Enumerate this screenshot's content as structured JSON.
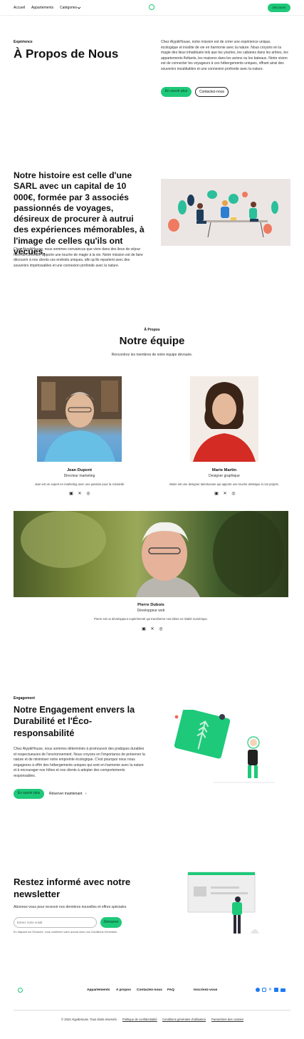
{
  "nav": {
    "links": [
      "Accueil",
      "Appartements",
      "Catégories"
    ],
    "cta": "Découvrir"
  },
  "about": {
    "kicker": "Expérience",
    "title": "À Propos de Nous",
    "text": "Chez AtypikHouse, notre mission est de créer une expérience unique, écologique et insolite de vie en harmonie avec la nature. Nous croyons en la magie des lieux inhabituels tels que les yourtes, les cabanes dans les arbres, les appartements flottants, les maisons dans les avions ou les bateaux. Notre vision est de connecter les voyageurs à ces hébergements uniques, offrant ainsi des souvenirs inoubliables et une connexion profonde avec la nature.",
    "primary": "En savoir plus",
    "secondary": "Contactez-nous"
  },
  "story": {
    "title": "Notre histoire est celle d'une SARL avec un capital de 10 000€, formée par 3 associés passionnés de voyages, désireux de procurer à autrui des expériences mémorables, à l'image de celles qu'ils ont vécues.",
    "text": "Chez AtypikHouse, nous sommes convaincus que vivre dans des lieux de séjour hors du commun, apporte une touche de magie à la vie. Notre mission est de faire découvrir à nos clients ces endroits uniques, afin qu'ils repartent avec des souvenirs impérissables et une connexion profonde avec la nature."
  },
  "team": {
    "kicker": "À Propos",
    "title": "Notre équipe",
    "subtitle": "Rencontrez les membres de notre équipe dévouée.",
    "members": [
      {
        "name": "Jean Dupont",
        "role": "Directeur marketing",
        "bio": "Jean est un expert en marketing avec une passion pour la créativité."
      },
      {
        "name": "Marie Martin",
        "role": "Designer graphique",
        "bio": "Marie est une designer talentueuse qui apporte une touche artistique à nos projets."
      },
      {
        "name": "Pierre Dubois",
        "role": "Développeur web",
        "bio": "Pierre est un développeur expérimenté qui transforme nos idées en réalité numérique."
      }
    ]
  },
  "engagement": {
    "kicker": "Engagement",
    "title": "Notre Engagement envers la Durabilité et l'Éco-responsabilité",
    "text": "Chez AtypikHouse, nous sommes déterminés à promouvoir des pratiques durables et respectueuses de l'environnement. Nous croyons en l'importance de préserver la nature et de minimiser notre empreinte écologique. C'est pourquoi nous nous engageons à offrir des hébergements uniques qui sont en harmonie avec la nature et à encourager nos hôtes et nos clients à adopter des comportements responsables.",
    "primary": "En savoir plus",
    "secondary": "Réserver maintenant"
  },
  "newsletter": {
    "title": "Restez informé avec notre newsletter",
    "subtitle": "Abonnez-vous pour recevoir nos dernières nouvelles et offres spéciales",
    "placeholder": "Entrez votre email",
    "button": "Démarrer",
    "legal": "En cliquant sur S'inscrire, vous confirmez votre accord avec nos Conditions Générales."
  },
  "footer": {
    "links": [
      "Appartements",
      "A propos",
      "Contactez-nous",
      "FAQ",
      "Inscrivez-vous"
    ],
    "copyright": "© 2024 AtypikHouse. Tous droits réservés.",
    "legal": [
      "Politique de confidentialité",
      "Conditions générales d'utilisation",
      "Paramètres des cookies"
    ]
  },
  "colors": {
    "accent": "#1ec97a",
    "dark": "#111111"
  },
  "icons": [
    "chevron-down-icon",
    "linkedin-icon",
    "x-icon",
    "dribbble-icon",
    "facebook-icon",
    "instagram-icon",
    "youtube-icon",
    "chevron-right-icon"
  ]
}
